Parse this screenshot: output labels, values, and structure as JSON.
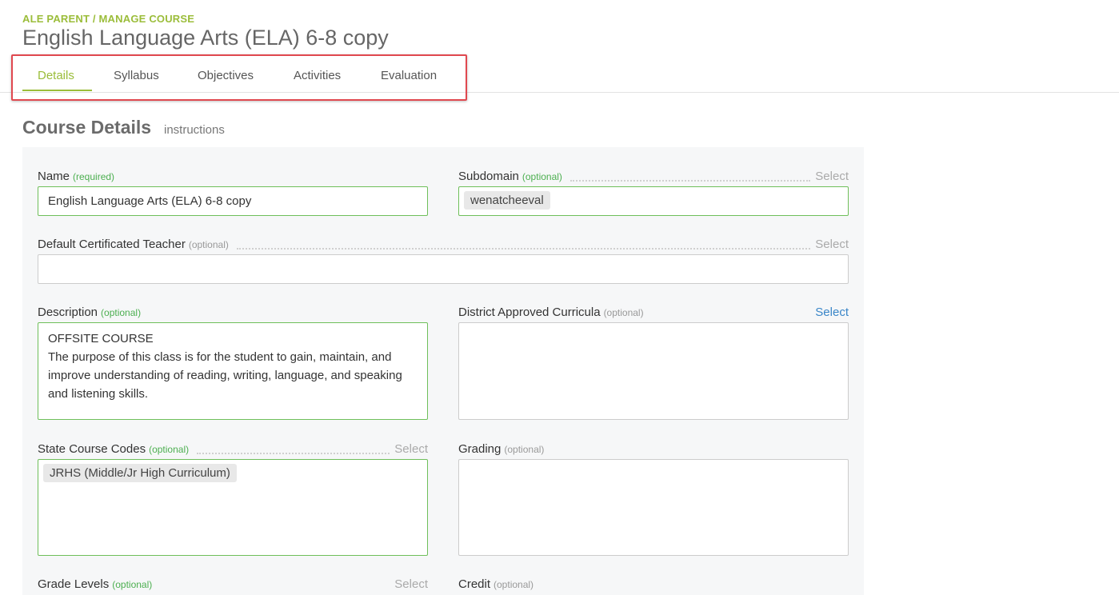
{
  "header": {
    "breadcrumb": "ALE PARENT / MANAGE COURSE",
    "title": "English Language Arts (ELA) 6-8 copy"
  },
  "tabs": [
    {
      "label": "Details",
      "active": true
    },
    {
      "label": "Syllabus",
      "active": false
    },
    {
      "label": "Objectives",
      "active": false
    },
    {
      "label": "Activities",
      "active": false
    },
    {
      "label": "Evaluation",
      "active": false
    }
  ],
  "section": {
    "title": "Course Details",
    "instructions": "instructions"
  },
  "fields": {
    "name": {
      "label": "Name",
      "tag": "(required)",
      "value": "English Language Arts (ELA) 6-8 copy"
    },
    "subdomain": {
      "label": "Subdomain",
      "tag": "(optional)",
      "select": "Select",
      "chip": "wenatcheeval"
    },
    "teacher": {
      "label": "Default Certificated Teacher",
      "tag": "(optional)",
      "select": "Select",
      "value": ""
    },
    "description": {
      "label": "Description",
      "tag": "(optional)",
      "line1": "OFFSITE COURSE",
      "line2": "The purpose of this class is for the student to gain, maintain, and improve understanding of reading, writing, language, and speaking and listening skills."
    },
    "curricula": {
      "label": "District Approved Curricula",
      "tag": "(optional)",
      "select": "Select"
    },
    "state_codes": {
      "label": "State Course Codes",
      "tag": "(optional)",
      "select": "Select",
      "chip": "JRHS (Middle/Jr High Curriculum)"
    },
    "grading": {
      "label": "Grading",
      "tag": "(optional)"
    },
    "grade_levels": {
      "label": "Grade Levels",
      "tag": "(optional)",
      "select": "Select"
    },
    "credit": {
      "label": "Credit",
      "tag": "(optional)"
    }
  },
  "colors": {
    "accent": "#9bbd3a",
    "required_tag": "#4caf50",
    "valid_border": "#6fbf5a",
    "link": "#3a86c8",
    "highlight": "#e0484f"
  }
}
